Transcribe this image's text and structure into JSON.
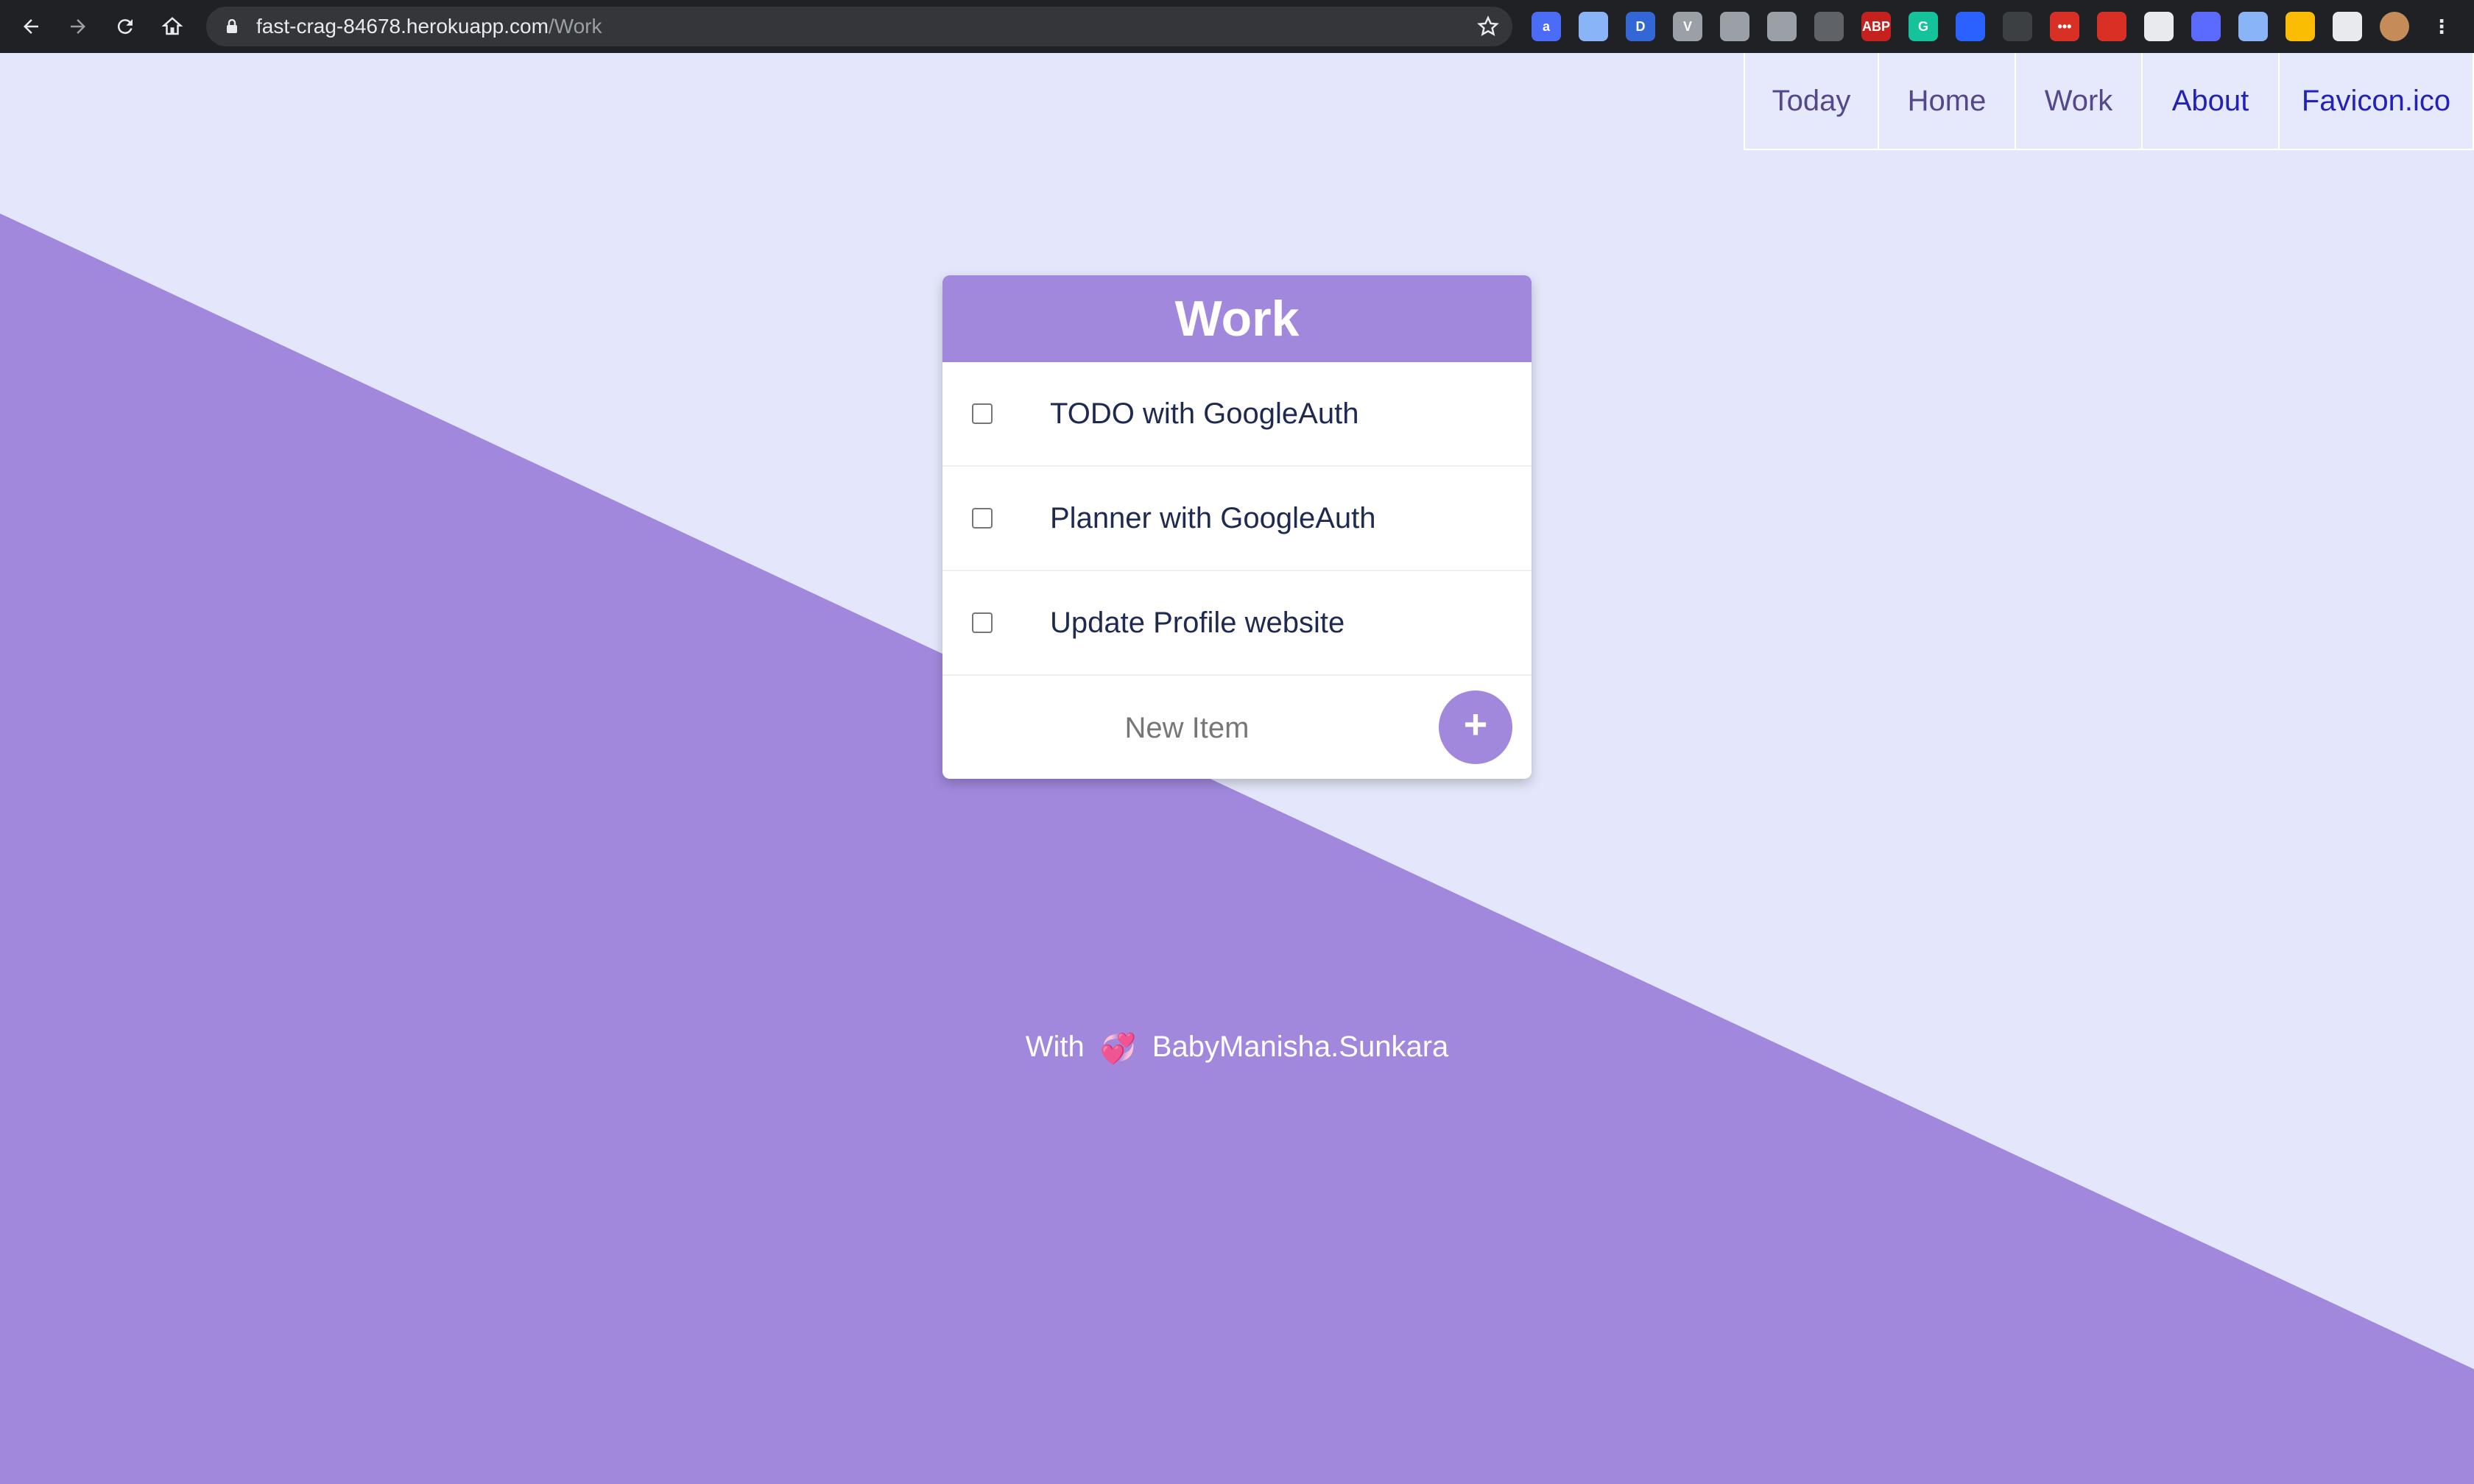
{
  "browser": {
    "url_host": "fast-crag-84678.herokuapp.com",
    "url_path": "/Work",
    "icons": [
      "back-arrow-icon",
      "forward-arrow-icon",
      "reload-icon",
      "home-icon",
      "lock-icon",
      "bookmark-star-icon"
    ],
    "extensions": [
      {
        "name": "extension-a-icon",
        "label": "a",
        "color": "#4a6cf7"
      },
      {
        "name": "extension-page-icon",
        "label": "",
        "color": "#8ab4f8"
      },
      {
        "name": "extension-d-icon",
        "label": "D",
        "color": "#3367d6"
      },
      {
        "name": "extension-v-icon",
        "label": "V",
        "color": "#9aa0a6"
      },
      {
        "name": "extension-gear-icon",
        "label": "",
        "color": "#9aa0a6"
      },
      {
        "name": "extension-pocket-icon",
        "label": "",
        "color": "#9aa0a6"
      },
      {
        "name": "extension-check-icon",
        "label": "",
        "color": "#5f6368"
      },
      {
        "name": "extension-abp-icon",
        "label": "ABP",
        "color": "#c5221f"
      },
      {
        "name": "extension-grammarly-icon",
        "label": "G",
        "color": "#15c39a"
      },
      {
        "name": "extension-blue-icon",
        "label": "",
        "color": "#2962ff"
      },
      {
        "name": "extension-github-icon",
        "label": "",
        "color": "#3c4043"
      },
      {
        "name": "extension-dots-icon",
        "label": "•••",
        "color": "#d93025"
      },
      {
        "name": "extension-block-icon",
        "label": "",
        "color": "#d93025"
      },
      {
        "name": "extension-qr-icon",
        "label": "",
        "color": "#e8eaed"
      },
      {
        "name": "extension-pen-icon",
        "label": "",
        "color": "#5b6bff"
      },
      {
        "name": "extension-image-icon",
        "label": "",
        "color": "#8ab4f8"
      },
      {
        "name": "extension-color-icon",
        "label": "",
        "color": "#fbbc04"
      },
      {
        "name": "extensions-puzzle-icon",
        "label": "",
        "color": "#e8eaed"
      },
      {
        "name": "profile-avatar",
        "label": "",
        "color": "#c58c5a"
      },
      {
        "name": "menu-kebab-icon",
        "label": "",
        "color": "#e8eaed"
      }
    ]
  },
  "nav": {
    "today": "Today",
    "home": "Home",
    "work": "Work",
    "about": "About",
    "favicon": "Favicon.ico"
  },
  "list": {
    "title": "Work",
    "items": [
      {
        "label": "TODO with GoogleAuth",
        "checked": false
      },
      {
        "label": "Planner with GoogleAuth",
        "checked": false
      },
      {
        "label": "Update Profile website",
        "checked": false
      }
    ],
    "new_item_placeholder": "New Item",
    "add_button_label": "+"
  },
  "footer": {
    "prefix": "With",
    "heart": "💞",
    "author": "BabyManisha.Sunkara"
  },
  "colors": {
    "background_light": "#e4e7fb",
    "background_purple": "#a188dd",
    "header_purple": "#a188dd",
    "nav_text": "#54478c",
    "nav_link_blue": "#2222bb"
  }
}
